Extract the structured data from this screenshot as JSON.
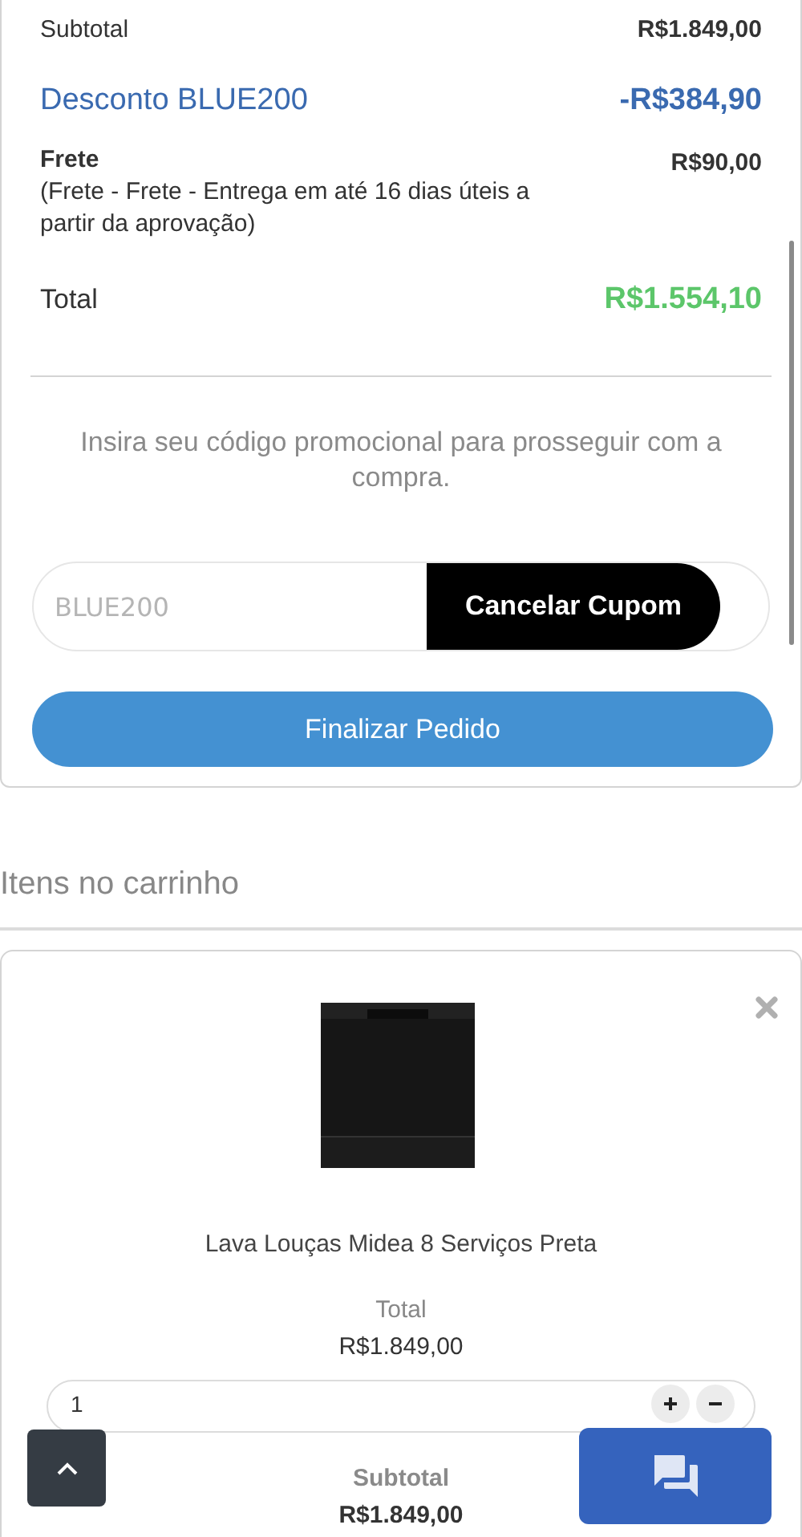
{
  "summary": {
    "subtotal": {
      "label": "Subtotal",
      "value": "R$1.849,00"
    },
    "discount": {
      "label": "Desconto BLUE200",
      "value": "-R$384,90"
    },
    "shipping": {
      "label": "Frete",
      "detail": "(Frete - Frete - Entrega em até 16 dias úteis a partir da aprovação)",
      "value": "R$90,00"
    },
    "total": {
      "label": "Total",
      "value": "R$1.554,10"
    },
    "promo_text": "Insira seu código promocional para prosseguir com a compra.",
    "coupon": {
      "placeholder": "BLUE200",
      "button": "Cancelar Cupom"
    },
    "checkout_button": "Finalizar Pedido"
  },
  "cart": {
    "title": "Itens no carrinho",
    "items": [
      {
        "name": "Lava Louças Midea 8 Serviços Preta",
        "total_label": "Total",
        "total": "R$1.849,00",
        "quantity": "1",
        "subtotal_label": "Subtotal",
        "subtotal": "R$1.849,00"
      }
    ]
  }
}
